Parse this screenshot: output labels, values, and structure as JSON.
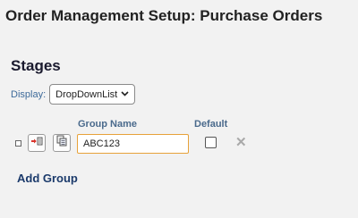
{
  "page": {
    "title": "Order Management Setup: Purchase Orders"
  },
  "stages": {
    "title": "Stages",
    "display_label": "Display:",
    "display_value": "DropDownList",
    "columns": {
      "group_name": "Group Name",
      "default": "Default"
    },
    "groups": [
      {
        "name": "ABC123",
        "default": false
      }
    ],
    "add_group_label": "Add Group"
  },
  "icons": {
    "move": "move-in-icon",
    "copy": "copy-icon",
    "remove": "remove-x-icon",
    "chevron": "chevron-down-icon"
  },
  "colors": {
    "background": "#f2f2f2",
    "input_focus_border": "#e7a23a",
    "link": "#1b3a6b",
    "column_header": "#4a6a8c",
    "move_icon_accent": "#d9342b"
  }
}
